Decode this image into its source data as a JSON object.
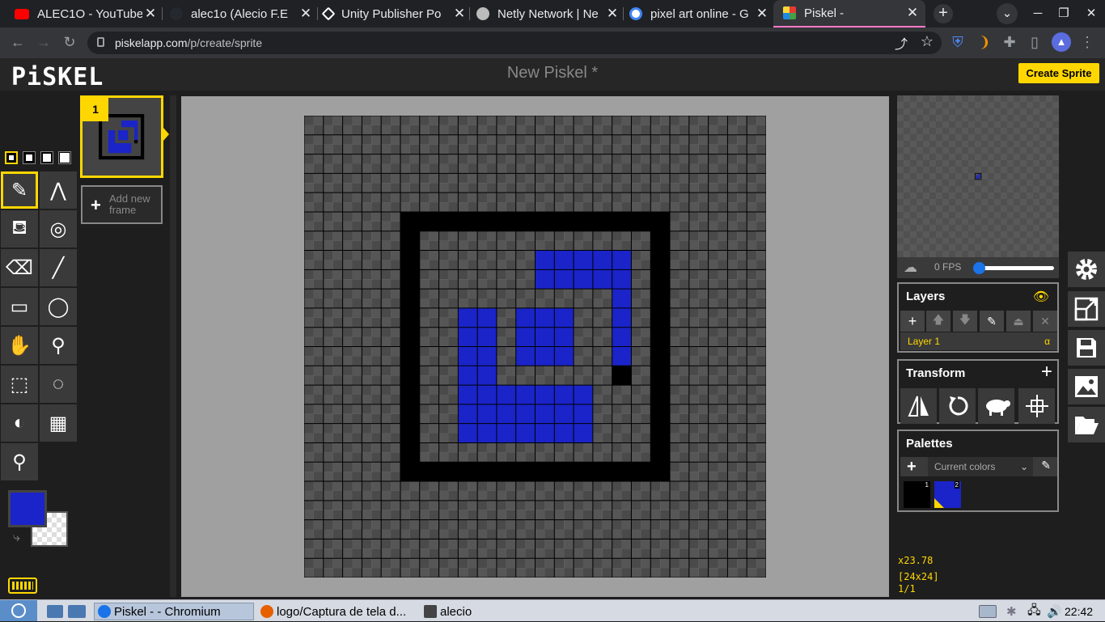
{
  "browser": {
    "tabs": [
      {
        "title": "ALEC1O - YouTube",
        "icon": "youtube-icon",
        "color": "#ff0000"
      },
      {
        "title": "alec1o (Alecio F.E",
        "icon": "github-icon",
        "color": "#24292f"
      },
      {
        "title": "Unity Publisher Po",
        "icon": "unity-icon",
        "color": "#ffffff"
      },
      {
        "title": "Netly Network | Ne",
        "icon": "netly-icon",
        "color": "#bbbbbb"
      },
      {
        "title": "pixel art online - G",
        "icon": "google-icon",
        "color": "#4285f4"
      },
      {
        "title": "Piskel -",
        "icon": "piskel-icon",
        "color": "#3f51b5"
      }
    ],
    "new_tab": "+",
    "url_host": "piskelapp.com",
    "url_path": "/p/create/sprite"
  },
  "app": {
    "logo": "PiSKEL",
    "title": "New Piskel *",
    "create_button": "Create Sprite"
  },
  "frames": {
    "frame_number": "1",
    "add_frame": "Add new frame"
  },
  "tools": [
    "pen-tool",
    "vertical-mirror-tool",
    "paint-bucket-tool",
    "paint-same-color-tool",
    "eraser-tool",
    "stroke-tool",
    "rectangle-tool",
    "circle-tool",
    "move-tool",
    "shape-selection-tool",
    "rectangle-selection-tool",
    "lasso-selection-tool",
    "lighten-tool",
    "dithering-tool",
    "color-picker-tool"
  ],
  "colors": {
    "primary": "#1a24c8",
    "secondary": "transparent",
    "accent": "#ffd700",
    "black": "#000000"
  },
  "sprite": {
    "size": 24,
    "pixels": [
      "........................",
      "........................",
      "........................",
      "........................",
      "........................",
      ".....##############.....",
      ".....#............#.....",
      ".....#......BBBBB.#.....",
      ".....#......BBBBB.#.....",
      ".....#..........B.#.....",
      ".....#..BB.BBB..B.#.....",
      ".....#..BB.BBB..B.#.....",
      ".....#..BB.BBB..B.#.....",
      ".....#..BB......#.#.....",
      ".....#..BBBBBBB...#.....",
      ".....#..BBBBBBB...#.....",
      ".....#..BBBBBBB...#.....",
      ".....#............#.....",
      ".....##############.....",
      "........................",
      "........................",
      "........................",
      "........................",
      "........................"
    ]
  },
  "preview": {
    "fps": "0 FPS",
    "fps_value": 0
  },
  "layers": {
    "title": "Layers",
    "layer_name": "Layer 1",
    "alpha": "α"
  },
  "transform": {
    "title": "Transform"
  },
  "palettes": {
    "title": "Palettes",
    "selected": "Current colors",
    "swatches": [
      {
        "color": "#000000",
        "index": "1"
      },
      {
        "color": "#1a24c8",
        "index": "2"
      }
    ]
  },
  "status": {
    "zoom": "x23.78",
    "dimensions": "[24x24]",
    "frames": "1/1"
  },
  "taskbar": {
    "items": [
      {
        "label": "Piskel - - Chromium",
        "icon": "chromium-icon"
      },
      {
        "label": "logo/Captura de tela d...",
        "icon": "firefox-icon"
      },
      {
        "label": "alecio",
        "icon": "folder-icon"
      }
    ],
    "clock": "22:42"
  }
}
